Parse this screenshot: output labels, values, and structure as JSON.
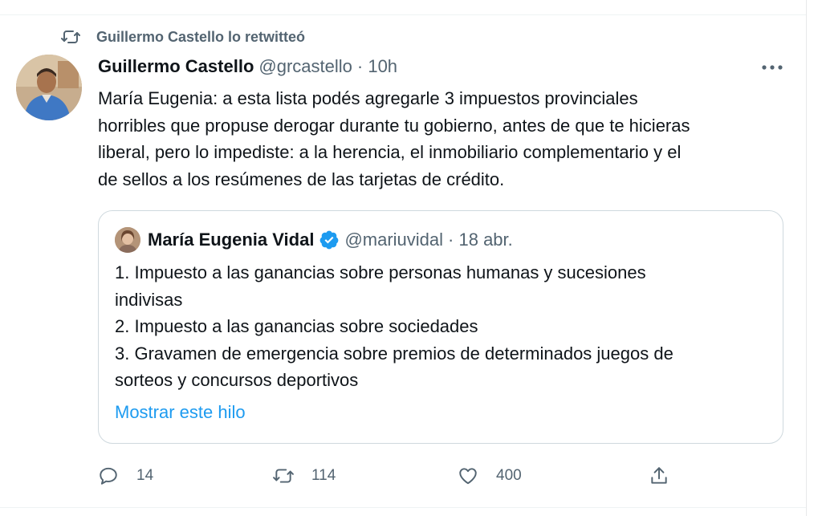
{
  "retweet": {
    "label": "Guillermo Castello lo retwitteó",
    "icon": "retweet-icon"
  },
  "tweet": {
    "author_name": "Guillermo Castello",
    "author_handle": "@grcastello",
    "time": "· 10h",
    "more_icon": "more-icon",
    "lines": [
      "María Eugenia: a esta lista podés agregarle 3 impuestos provinciales",
      "horribles que propuse derogar durante tu gobierno, antes de que te hicieras",
      "liberal, pero lo impediste: a la herencia, el inmobiliario complementario y el",
      "de sellos a los resúmenes de las tarjetas de crédito."
    ]
  },
  "quote": {
    "author_name": "María Eugenia Vidal",
    "author_handle": "@mariuvidal",
    "date": "· 18 abr.",
    "lines": [
      "1. Impuesto a las ganancias sobre personas humanas y sucesiones",
      "indivisas",
      "2. Impuesto a las ganancias sobre sociedades",
      "3. Gravamen de emergencia sobre premios de determinados juegos de",
      "sorteos y concursos deportivos"
    ],
    "show_thread": "Mostrar este hilo"
  },
  "actions": {
    "reply_count": "14",
    "retweet_count": "114",
    "like_count": "400"
  },
  "colors": {
    "accent": "#1d9bf0",
    "muted": "#536471",
    "text": "#0f1419",
    "border": "#cfd9de"
  }
}
